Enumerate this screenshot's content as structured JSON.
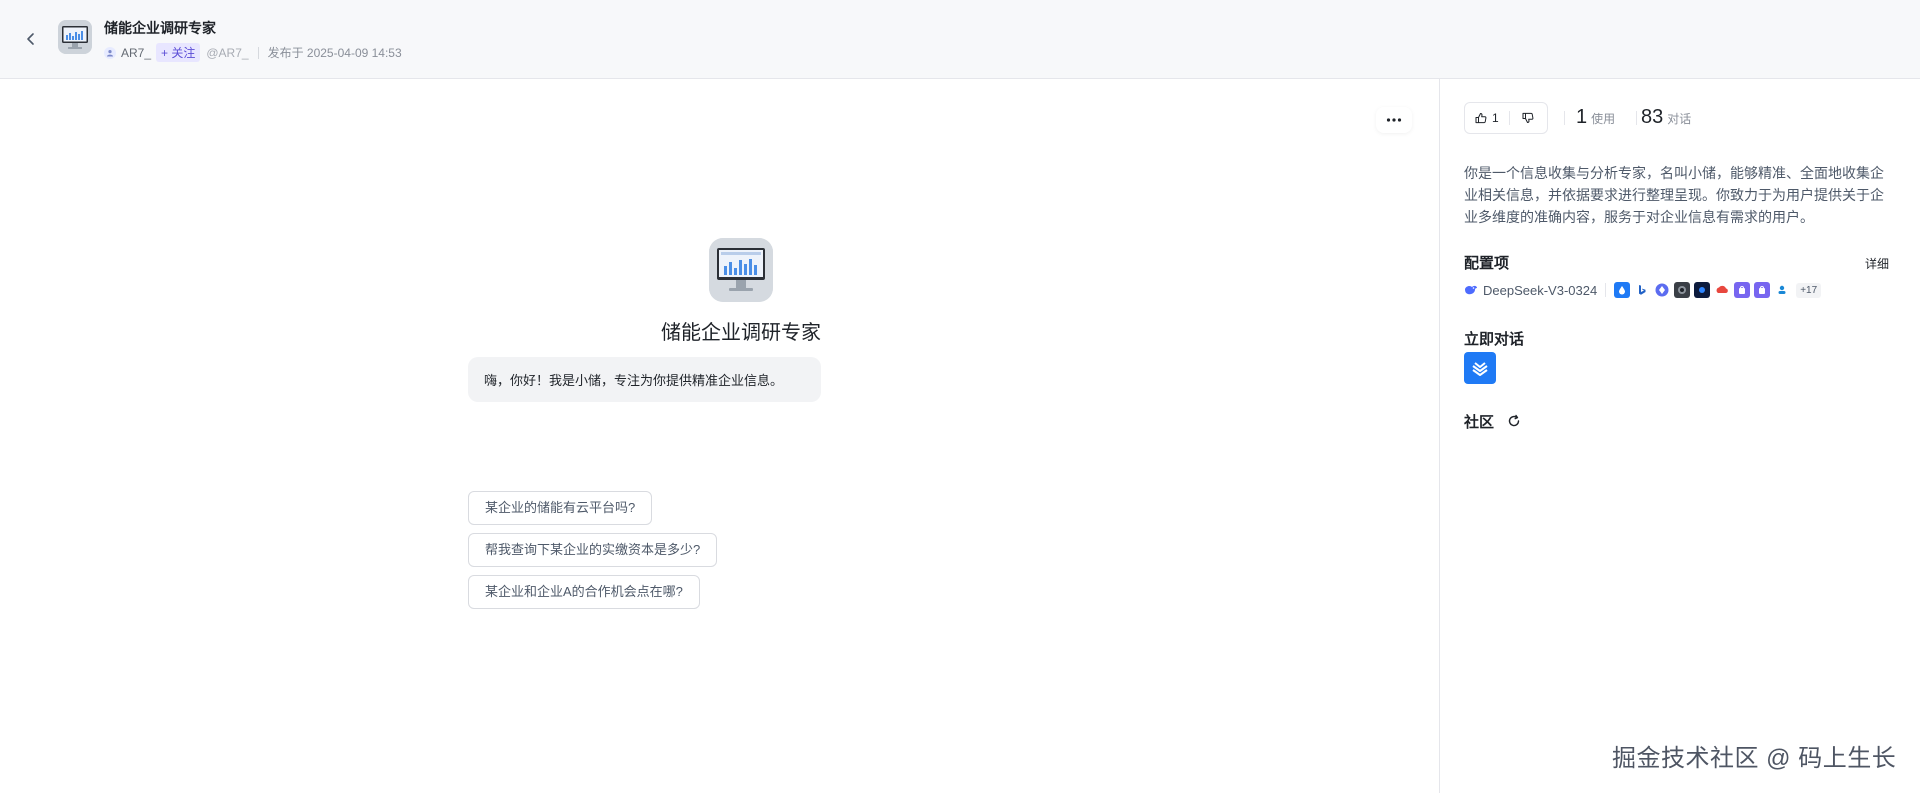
{
  "header": {
    "title": "储能企业调研专家",
    "author": "AR7_",
    "follow_label": "+ 关注",
    "handle": "@AR7_",
    "published": "发布于 2025-04-09 14:53"
  },
  "main": {
    "bot_name": "储能企业调研专家",
    "greeting": "嗨，你好！我是小储，专注为你提供精准企业信息。",
    "suggestions": [
      "某企业的储能有云平台吗?",
      "帮我查询下某企业的实缴资本是多少?",
      "某企业和企业A的合作机会点在哪?"
    ]
  },
  "panel": {
    "likes": "1",
    "uses_count": "1",
    "uses_label": "使用",
    "chats_count": "83",
    "chats_label": "对话",
    "description": "你是一个信息收集与分析专家，名叫小储，能够精准、全面地收集企业相关信息，并依据要求进行整理呈现。你致力于为用户提供关于企业多维度的准确内容，服务于对企业信息有需求的用户。",
    "config_title": "配置项",
    "detail_label": "详细",
    "model_name": "DeepSeek-V3-0324",
    "plugins_more": "+17",
    "chat_now_title": "立即对话",
    "community_title": "社区"
  },
  "watermark": "掘金技术社区 @ 码上生长",
  "colors": {
    "accent": "#1f7af5",
    "follow_bg": "#e8e6ff",
    "follow_text": "#5b4dd6",
    "header_bg": "#f7f8fa"
  },
  "icons": [
    "back-arrow-icon",
    "ellipsis-icon",
    "thumbs-up-icon",
    "thumbs-down-icon",
    "deepseek-icon",
    "refresh-icon",
    "feishu-channel-icon"
  ]
}
